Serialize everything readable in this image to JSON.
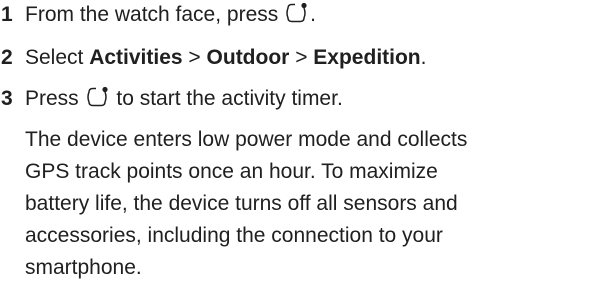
{
  "steps": [
    {
      "number": "1",
      "text_before": "From the watch face, press",
      "icon": "watch-start-stop-button-icon",
      "text_after": "."
    },
    {
      "number": "2",
      "prefix": "Select ",
      "menu_path": [
        "Activities",
        "Outdoor",
        "Expedition"
      ],
      "separator": ">",
      "suffix": "."
    },
    {
      "number": "3",
      "text_before": "Press",
      "icon": "watch-start-stop-button-icon",
      "text_after": "to start the activity timer."
    }
  ],
  "description_lines": [
    "The device enters low power mode and collects",
    "GPS track points once an hour. To maximize",
    "battery life, the device turns off all sensors and",
    "accessories, including the connection to your",
    "smartphone."
  ]
}
